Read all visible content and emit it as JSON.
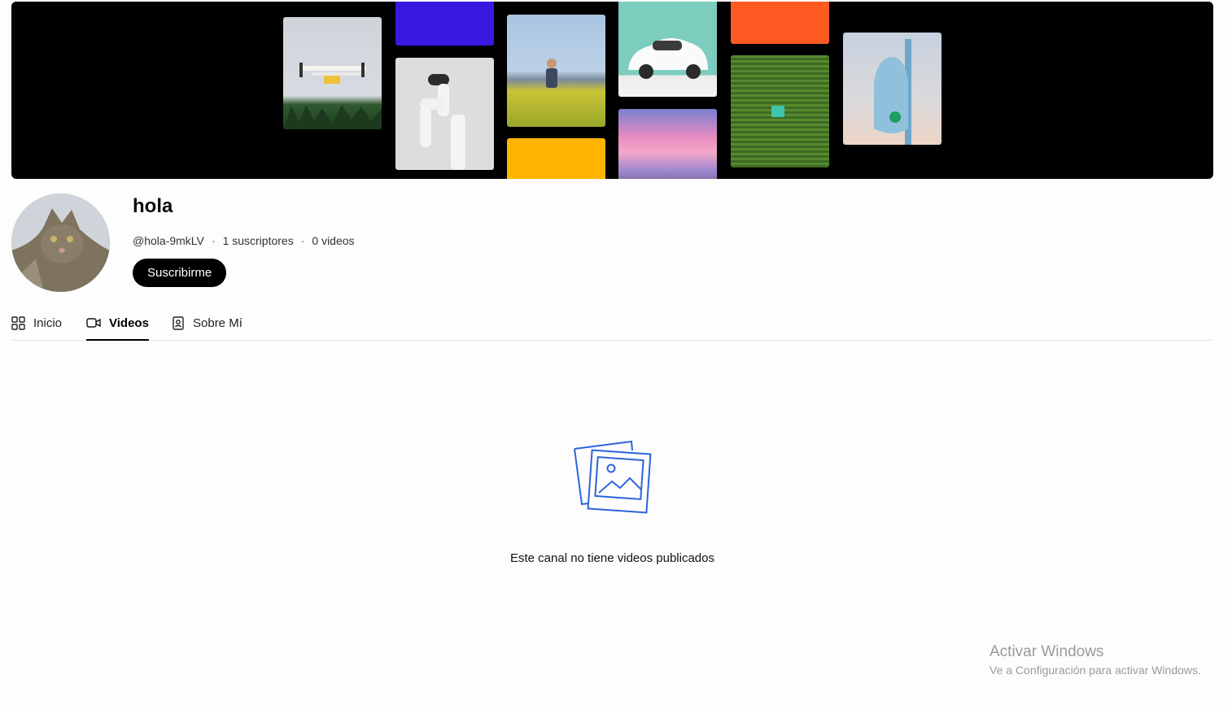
{
  "channel": {
    "name": "hola",
    "handle": "@hola-9mkLV",
    "subscribers": "1 suscriptores",
    "videos": "0 videos",
    "subscribe_label": "Suscribirme"
  },
  "tabs": [
    {
      "label": "Inicio",
      "icon": "grid-icon"
    },
    {
      "label": "Videos",
      "icon": "video-camera-icon",
      "active": true
    },
    {
      "label": "Sobre Mí",
      "icon": "contact-book-icon"
    }
  ],
  "empty_state": {
    "icon": "image-gallery-icon",
    "message": "Este canal no tiene videos publicados"
  },
  "banner": {
    "background": "#000000",
    "tiles": [
      "drone",
      "blue-block",
      "robot-arm",
      "field-person",
      "yellow-block",
      "self-driving-car",
      "pink-sky",
      "orange-block",
      "crop-field-robot",
      "sensor-pole"
    ],
    "colors": {
      "blue": "#3a17e0",
      "yellow": "#ffb400",
      "orange": "#ff5a22",
      "teal": "#7ccdbd"
    }
  },
  "watermark": {
    "title": "Activar Windows",
    "subtitle": "Ve a Configuración para activar Windows."
  },
  "colors": {
    "accent": "#000000",
    "empty_icon": "#2b65d9",
    "background": "#fdfdfd"
  }
}
